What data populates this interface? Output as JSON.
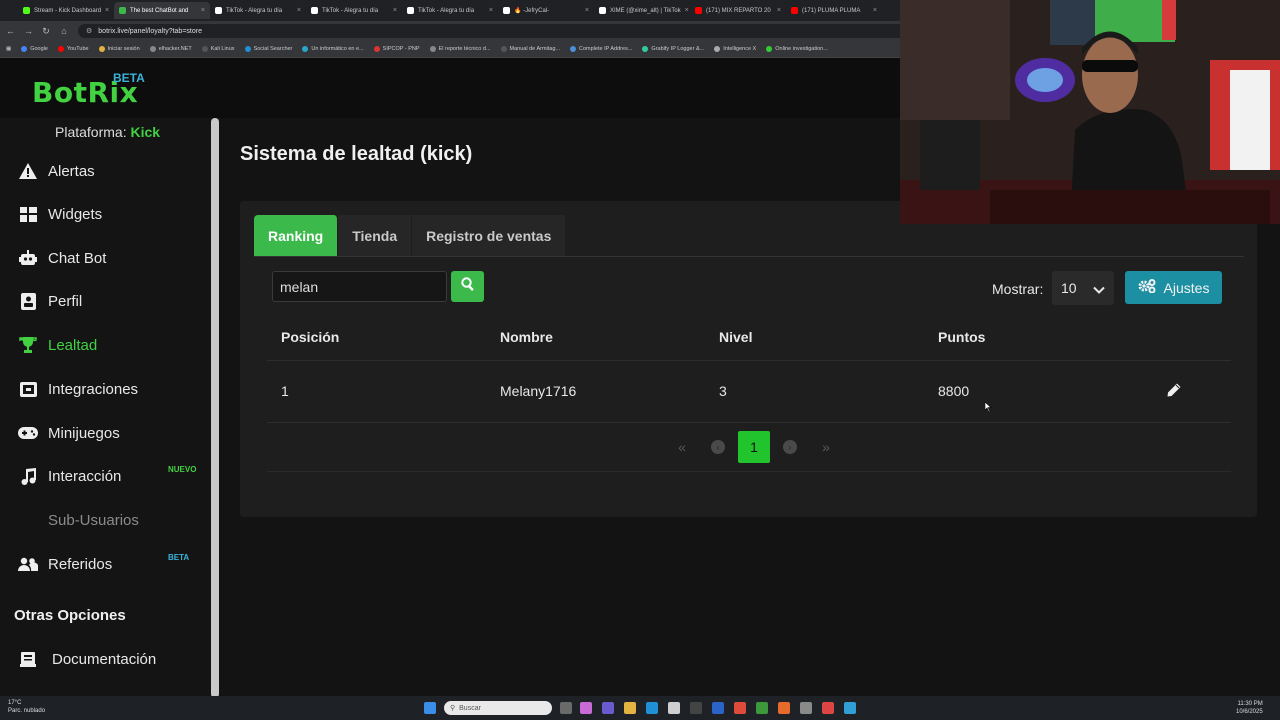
{
  "browser": {
    "tabs": [
      {
        "label": "Stream - Kick Dashboard",
        "color": "#53fc18"
      },
      {
        "label": "The best ChatBot and",
        "color": "#3bb94a",
        "active": true
      },
      {
        "label": "TikTok - Alegra tu día",
        "color": "#ffffff"
      },
      {
        "label": "TikTok - Alegra tu día",
        "color": "#ffffff"
      },
      {
        "label": "TikTok - Alegra tu día",
        "color": "#ffffff"
      },
      {
        "label": "🔥 -JefryCal- ",
        "color": "#ffffff"
      },
      {
        "label": "XIME (@xime_alt) | TikTok",
        "color": "#ffffff"
      },
      {
        "label": "(171) MIX REPARTO 20",
        "color": "#ff0000"
      },
      {
        "label": "(171) PLUMA PLUMA",
        "color": "#ff0000"
      }
    ],
    "url": "botrix.live/panel/loyalty?tab=store",
    "bookmarks": [
      "Google",
      "YouTube",
      "Iniciar sesión",
      "elhacker.NET",
      "Kali Linux",
      "Social Searcher",
      "Un informático en e...",
      "SIPCOP - PNP",
      "El reporte técnico d...",
      "Manual de Armitag...",
      "Complete IP Addres...",
      "Grabify IP Logger &...",
      "Intelligence X",
      "Online investigation..."
    ]
  },
  "header": {
    "logo": "BotRix",
    "logo_badge": "BETA"
  },
  "sidebar": {
    "platform_label": "Plataforma:",
    "platform_value": "Kick",
    "items": [
      {
        "label": "Alertas",
        "icon": "warning-icon"
      },
      {
        "label": "Widgets",
        "icon": "grid-icon"
      },
      {
        "label": "Chat Bot",
        "icon": "robot-icon"
      },
      {
        "label": "Perfil",
        "icon": "id-card-icon"
      },
      {
        "label": "Lealtad",
        "icon": "trophy-icon",
        "active": true
      },
      {
        "label": "Integraciones",
        "icon": "plug-icon"
      },
      {
        "label": "Minijuegos",
        "icon": "gamepad-icon"
      },
      {
        "label": "Interacción",
        "icon": "music-icon",
        "badge": "NUEVO"
      },
      {
        "label": "Sub-Usuarios",
        "icon": "none",
        "disabled": true
      },
      {
        "label": "Referidos",
        "icon": "users-icon",
        "badge": "BETA"
      }
    ],
    "section_title": "Otras Opciones",
    "other_items": [
      {
        "label": "Documentación",
        "icon": "book-icon"
      }
    ],
    "colors": {
      "accent": "#41d141",
      "nuevo": "#41d141",
      "beta": "#3ab3d9"
    }
  },
  "main": {
    "title": "Sistema de lealtad (kick)",
    "tabs": [
      {
        "label": "Ranking",
        "active": true
      },
      {
        "label": "Tienda"
      },
      {
        "label": "Registro de ventas"
      }
    ],
    "search": {
      "value": "melan",
      "placeholder": ""
    },
    "show_label": "Mostrar:",
    "show_value": "10",
    "settings_button": "Ajustes",
    "table": {
      "headers": [
        "Posición",
        "Nombre",
        "Nivel",
        "Puntos"
      ],
      "rows": [
        {
          "position": "1",
          "name": "Melany1716",
          "level": "3",
          "points": "8800"
        }
      ]
    },
    "pagination": {
      "first": "«",
      "prev": "‹",
      "current": "1",
      "next": "›",
      "last": "»"
    },
    "colors": {
      "primary": "#3bb94a",
      "info": "#1d8fa3"
    }
  },
  "taskbar": {
    "weather_temp": "17°C",
    "weather_desc": "Parc. nublado",
    "search_placeholder": "Buscar",
    "time": "11:30 PM",
    "date": "10/6/2025"
  }
}
